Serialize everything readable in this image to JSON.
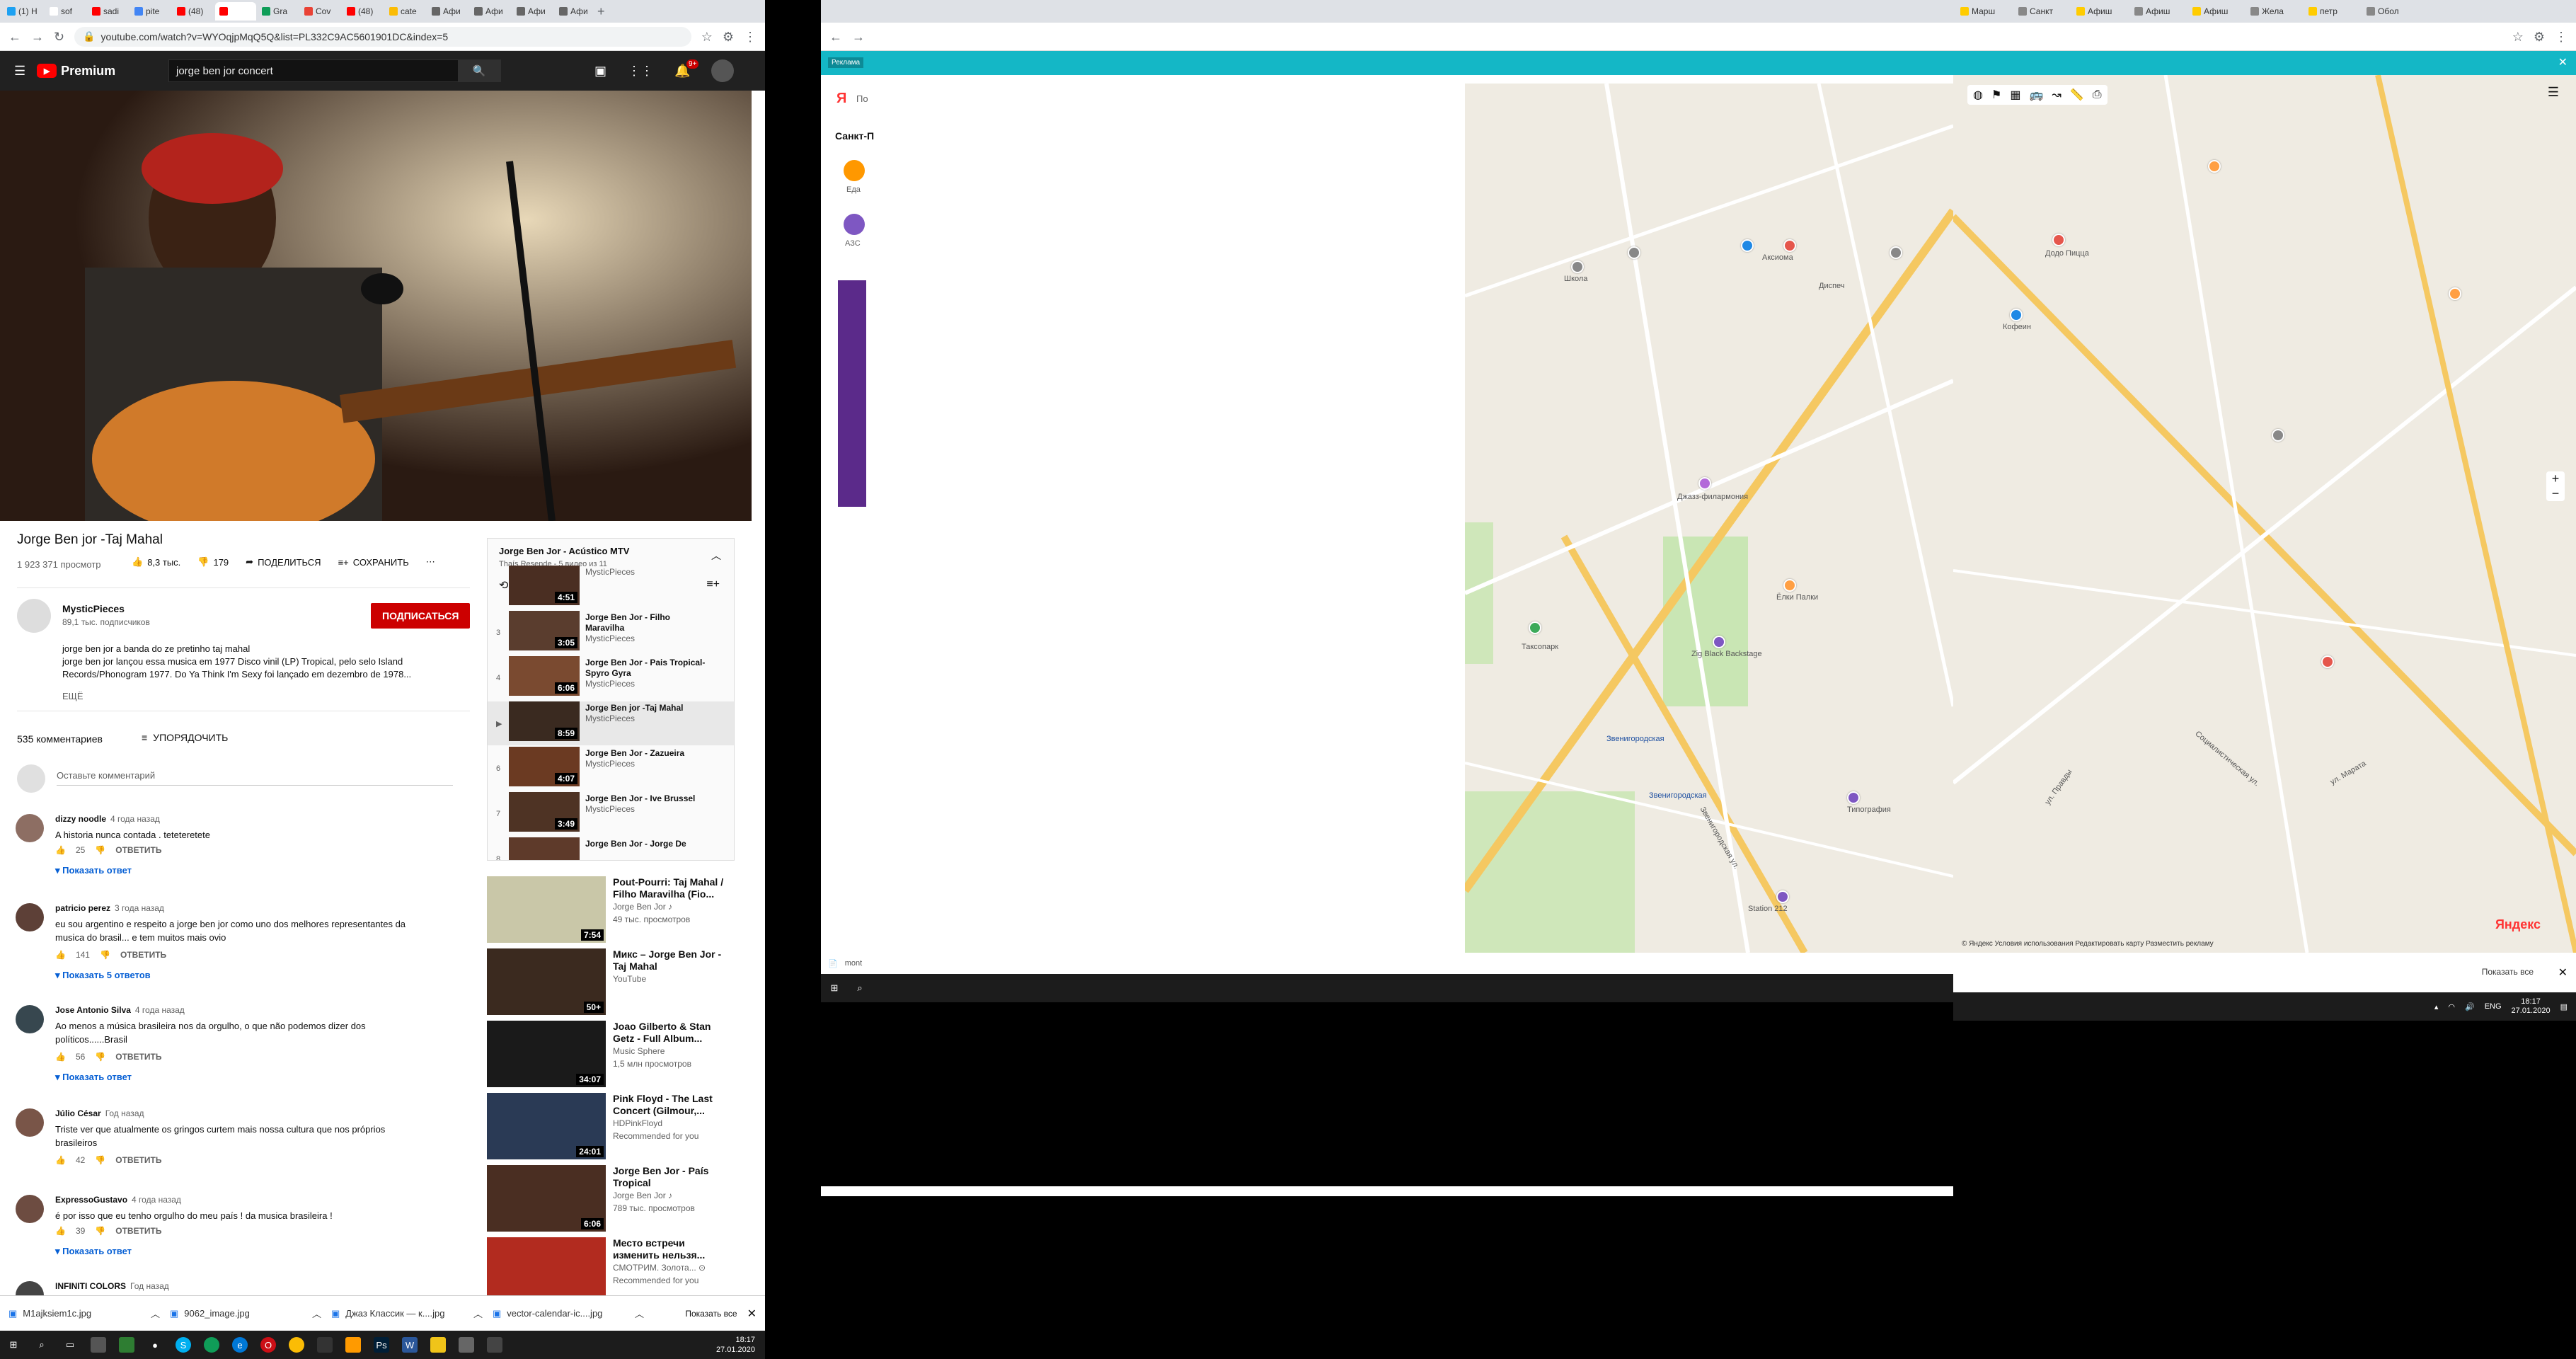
{
  "left": {
    "tabs": [
      "(1) H",
      "sof",
      "sadi",
      "pite",
      "(48)",
      "",
      "Gra",
      "Cov",
      "(48)",
      "cate",
      "Афи",
      "Афи",
      "Афи",
      "Афи"
    ],
    "url": "youtube.com/watch?v=WYOqjpMqQ5Q&list=PL332C9AC5601901DC&index=5",
    "yt_logo": "Premium",
    "search_value": "jorge ben jor concert",
    "notif_count": "9+",
    "video_title": "Jorge Ben jor -Taj Mahal",
    "views": "1 923 371 просмотр",
    "likes": "8,3 тыс.",
    "dislikes": "179",
    "share": "ПОДЕЛИТЬСЯ",
    "save": "СОХРАНИТЬ",
    "channel": "MysticPieces",
    "subscribers": "89,1 тыс. подписчиков",
    "subscribe": "ПОДПИСАТЬСЯ",
    "desc1": "jorge ben jor a banda do ze pretinho taj mahal",
    "desc2": "jorge ben jor lançou essa musica em 1977 Disco vinil (LP) Tropical, pelo selo Island",
    "desc3": "Records/Phonogram 1977. Do Ya Think I'm Sexy foi lançado em dezembro de 1978...",
    "more": "ЕЩЁ",
    "comments_count": "535 комментариев",
    "sort": "УПОРЯДОЧИТЬ",
    "add_comment": "Оставьте комментарий",
    "reply_label": "ОТВЕТИТЬ",
    "comments": [
      {
        "author": "dizzy noodle",
        "time": "4 года назад",
        "text": "A historia nunca contada . teteteretete",
        "likes": "25",
        "replies": "Показать ответ"
      },
      {
        "author": "patricio perez",
        "time": "3 года назад",
        "text": "eu sou argentino e respeito a jorge ben jor como uno dos melhores representantes da",
        "text2": "musica do brasil... e tem muitos mais ovio",
        "likes": "141",
        "replies": "Показать 5 ответов"
      },
      {
        "author": "Jose Antonio Silva",
        "time": "4 года назад",
        "text": "Ao menos a música brasileira nos da orgulho, o que não podemos dizer dos",
        "text2": "políticos......Brasil",
        "likes": "56",
        "replies": "Показать ответ"
      },
      {
        "author": "Júlio César",
        "time": "Год назад",
        "text": "Triste ver que atualmente os gringos curtem mais nossa cultura que nos próprios",
        "text2": "brasileiros",
        "likes": "42",
        "replies": ""
      },
      {
        "author": "ExpressoGustavo",
        "time": "4 года назад",
        "text": "é por isso que eu tenho orgulho do meu país ! da musica brasileira !",
        "likes": "39",
        "replies": "Показать ответ"
      },
      {
        "author": "INFINITI COLORS",
        "time": "Год назад",
        "text": "",
        "likes": "",
        "replies": ""
      }
    ],
    "playlist": {
      "title": "Jorge Ben Jor - Acústico MTV",
      "meta": "Thaís Resende - 5 видео из 11",
      "items": [
        {
          "num": "",
          "title": "",
          "channel": "MysticPieces",
          "dur": "4:51"
        },
        {
          "num": "3",
          "title": "Jorge Ben Jor - Filho",
          "title2": "Maravilha",
          "channel": "MysticPieces",
          "dur": "3:05"
        },
        {
          "num": "4",
          "title": "Jorge Ben Jor - Pais Tropical-",
          "title2": "Spyro Gyra",
          "channel": "MysticPieces",
          "dur": "6:06"
        },
        {
          "num": "▶",
          "title": "Jorge Ben jor -Taj Mahal",
          "title2": "",
          "channel": "MysticPieces",
          "dur": "8:59"
        },
        {
          "num": "6",
          "title": "Jorge Ben Jor - Zazueira",
          "title2": "",
          "channel": "MysticPieces",
          "dur": "4:07"
        },
        {
          "num": "7",
          "title": "Jorge Ben Jor - Ive Brussel",
          "title2": "",
          "channel": "MysticPieces",
          "dur": "3:49"
        },
        {
          "num": "8",
          "title": "Jorge Ben Jor - Jorge De",
          "title2": "",
          "channel": "",
          "dur": ""
        }
      ]
    },
    "recs": [
      {
        "t1": "Pout-Pourri: Taj Mahal /",
        "t2": "Filho Maravilha (Fio...",
        "m1": "Jorge Ben Jor ♪",
        "m2": "49 тыс. просмотров",
        "dur": "7:54",
        "color": "#c9c7a8"
      },
      {
        "t1": "Микс – Jorge Ben Jor -",
        "t2": "Taj Mahal",
        "m1": "YouTube",
        "m2": "",
        "dur": "50+",
        "color": "#3b2a1f"
      },
      {
        "t1": "Joao Gilberto & Stan",
        "t2": "Getz - Full Album...",
        "m1": "Music Sphere",
        "m2": "1,5 млн просмотров",
        "dur": "34:07",
        "color": "#1a1a1a"
      },
      {
        "t1": "Pink Floyd - The Last",
        "t2": "Concert (Gilmour,...",
        "m1": "HDPinkFloyd",
        "m2": "Recommended for you",
        "dur": "24:01",
        "color": "#2a3a55"
      },
      {
        "t1": "Jorge Ben Jor - País",
        "t2": "Tropical",
        "m1": "Jorge Ben Jor ♪",
        "m2": "789 тыс. просмотров",
        "dur": "6:06",
        "color": "#4a2e22"
      },
      {
        "t1": "Место встречи",
        "t2": "изменить нельзя...",
        "m1": "СМОТРИМ. Золота... ⊙",
        "m2": "Recommended for you",
        "dur": "",
        "color": "#b22b1f"
      }
    ],
    "downloads": [
      "M1ajksiem1c.jpg",
      "9062_image.jpg",
      "Джаз Классик — к....jpg",
      "vector-calendar-ic....jpg"
    ],
    "show_all": "Показать все",
    "clock_time": "18:17",
    "clock_date": "27.01.2020"
  },
  "right": {
    "tabs": [
      "Марш",
      "Санкт",
      "Афиш",
      "Афиш",
      "Афиш",
      "Жела",
      "петр",
      "Обол"
    ],
    "banner": "Реклама",
    "search_placeholder": "По",
    "city": "Санкт-П",
    "cat1": "Еда",
    "cat2": "АЗС",
    "download_file": "mont",
    "map_labels": {
      "street1": "Звенигородская ул.",
      "street2": "ул. Правды",
      "street3": "Социалистическая ул.",
      "street4": "ул. Марата",
      "metro1": "Звенигородская",
      "metro2": "Звенигородская",
      "poi1": "Аксиома",
      "poi2": "Джазз-филармония",
      "poi3": "Zig Black Backstage",
      "poi4": "Ёлки Палки",
      "poi5": "Таксопарк",
      "poi6": "Типография",
      "poi7": "Школа",
      "poi8": "Диспеч",
      "poi9": "Додо Пицца",
      "poi10": "Кофеин",
      "poi11": "Station 212"
    },
    "map_footer": "© Яндекс  Условия использования  Редактировать карту  Разместить рекламу",
    "yandex_logo": "Яндекс",
    "show_all": "Показать все",
    "lang": "ENG",
    "clock_time": "18:17",
    "clock_date": "27.01.2020"
  }
}
